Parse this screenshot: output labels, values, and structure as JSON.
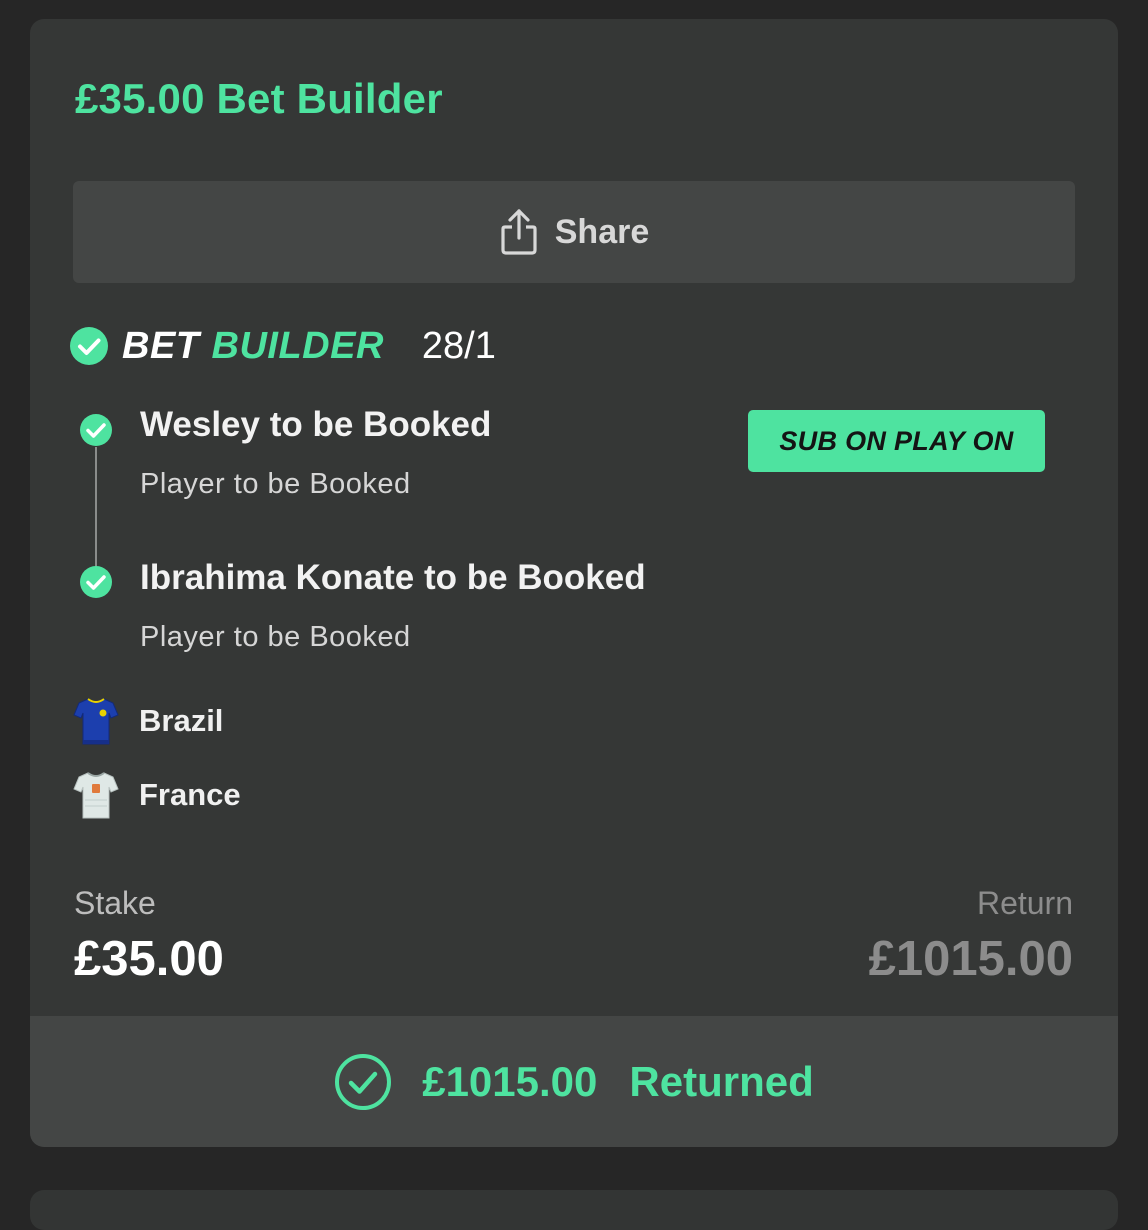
{
  "bet": {
    "title": "£35.00 Bet Builder",
    "share_label": "Share",
    "header": {
      "bet_word": "BET",
      "builder_word": "BUILDER",
      "odds": "28/1"
    },
    "promo_badge": "SUB ON PLAY ON",
    "legs": [
      {
        "name": "Wesley to be Booked",
        "market": "Player to be Booked",
        "status": "won"
      },
      {
        "name": "Ibrahima Konate to be Booked",
        "market": "Player to be Booked",
        "status": "won"
      }
    ],
    "teams": [
      {
        "name": "Brazil",
        "kit_icon": "brazil-kit-icon"
      },
      {
        "name": "France",
        "kit_icon": "france-kit-icon"
      }
    ],
    "stake": {
      "label": "Stake",
      "value": "£35.00"
    },
    "return": {
      "label": "Return",
      "value": "£1015.00"
    },
    "returned": {
      "amount": "£1015.00",
      "text": "Returned"
    }
  },
  "colors": {
    "accent": "#4ee3a0",
    "background": "#262626",
    "card": "#353736",
    "panel": "#444645",
    "muted_text": "#8c8c8c"
  }
}
